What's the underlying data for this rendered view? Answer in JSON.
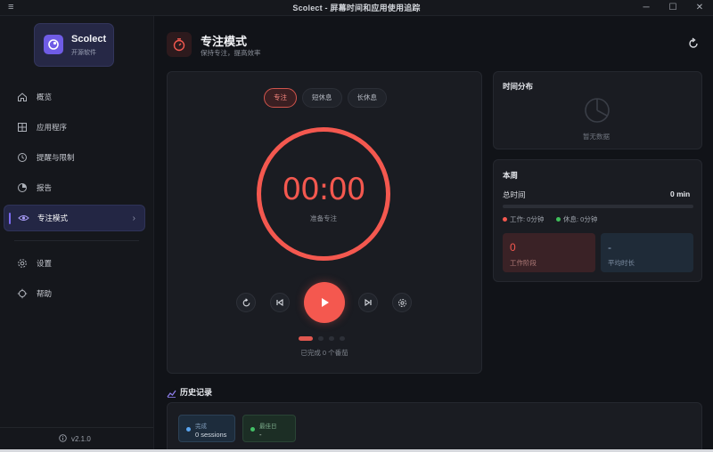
{
  "window": {
    "title": "Scolect - 屏幕时间和应用使用追踪",
    "controls": [
      "─",
      "☐",
      "✕"
    ],
    "menu_icon": "≡"
  },
  "brand": {
    "name": "Scolect",
    "subtitle": "开源软件"
  },
  "sidebar": {
    "items": [
      {
        "label": "概览",
        "icon": "home-icon"
      },
      {
        "label": "应用程序",
        "icon": "apps-grid-icon"
      },
      {
        "label": "提醒与限制",
        "icon": "reminder-clock-icon"
      },
      {
        "label": "报告",
        "icon": "report-chart-icon"
      },
      {
        "label": "专注模式",
        "icon": "eye-icon",
        "active": true
      },
      {
        "label": "设置",
        "icon": "gear-icon"
      },
      {
        "label": "帮助",
        "icon": "help-icon"
      }
    ],
    "version": "v2.1.0"
  },
  "header": {
    "title": "专注模式",
    "subtitle": "保持专注，提高效率"
  },
  "timer": {
    "modes": [
      "专注",
      "短休息",
      "长休息"
    ],
    "active_mode": "专注",
    "display": "00:00",
    "state_label": "准备专注",
    "cycle_text": "已完成 0 个番茄",
    "cycle_total": 4,
    "cycle_current": 1
  },
  "distribution": {
    "title": "时间分布",
    "empty_text": "暂无数据"
  },
  "week": {
    "title": "本周",
    "total_label": "总时间",
    "total_value": "0 min",
    "progress": 0,
    "legend_work": "工作: 0分钟",
    "legend_rest": "休息: 0分钟",
    "work_sessions_value": "0",
    "work_sessions_label": "工作阶段",
    "avg_value": "-",
    "avg_label": "平均时长"
  },
  "history": {
    "title": "历史记录",
    "chips": [
      {
        "key": "完成",
        "value": "0 sessions"
      },
      {
        "key": "最佳日",
        "value": "-"
      }
    ]
  },
  "colors": {
    "accent": "#f4584f",
    "brand": "#6f5ce6",
    "background": "#111318",
    "card": "#1a1c22"
  }
}
